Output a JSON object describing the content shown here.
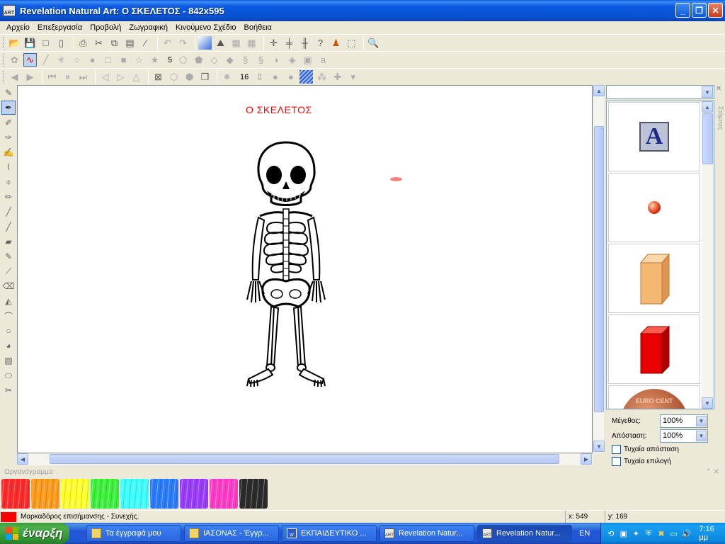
{
  "window": {
    "title": "Revelation Natural Art: Ο ΣΚΕΛΕΤΟΣ - 842x595",
    "app_icon_text": "ART"
  },
  "menu": [
    "Αρχείο",
    "Επεξεργασία",
    "Προβολή",
    "Ζωγραφική",
    "Κινούμενο Σχέδιο",
    "Βοήθεια"
  ],
  "toolbar2": {
    "size_value": "5"
  },
  "toolbar3": {
    "brush_size": "16"
  },
  "canvas": {
    "title": "Ο ΣΚΕΛΕΤΟΣ"
  },
  "right_panel": {
    "side_tab": "Στάμπες",
    "size_label": "Μέγεθος:",
    "size_value": "100%",
    "distance_label": "Απόσταση:",
    "distance_value": "100%",
    "random_distance": "Τυχαία απόσταση",
    "random_choice": "Τυχαία επιλογή",
    "stamp_letter": "A",
    "coin_text": "EURO CENT"
  },
  "organizer": {
    "title": "Οργανόγραμμα"
  },
  "palette": [
    "#ff2a2a",
    "#ff9a1a",
    "#ffff2a",
    "#3cf03c",
    "#3cffff",
    "#2a7cff",
    "#9a3cff",
    "#ff3cc8",
    "#2b2b2b"
  ],
  "status": {
    "text": "Μαρκαδόρος επισήμανσης - Συνεχής.",
    "x": "x: 549",
    "y": "y: 169",
    "color": "#ff0000"
  },
  "taskbar": {
    "start": "έναρξη",
    "tasks": [
      "Τα έγγραφά μου",
      "ΙΑΣΟΝΑΣ - Έγγρ...",
      "ΕΚΠΑΙΔΕΥΤΙΚΟ ...",
      "Revelation Natur...",
      "Revelation Natur..."
    ],
    "lang": "EN",
    "clock": "7:16 μμ"
  }
}
